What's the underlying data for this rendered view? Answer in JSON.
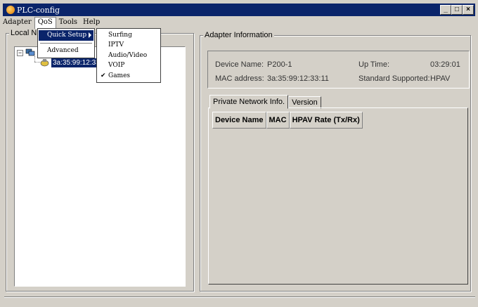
{
  "window": {
    "title": "PLC-config"
  },
  "menubar": {
    "items": [
      "Adapter",
      "QoS",
      "Tools",
      "Help"
    ]
  },
  "qos_menu": {
    "items": [
      "Quick Setup",
      "Advanced"
    ]
  },
  "quick_setup_menu": {
    "items": [
      "Surfing",
      "IPTV",
      "Audio/Video",
      "VOIP",
      "Games"
    ],
    "checked": "Games"
  },
  "local_network": {
    "title": "Local N",
    "selected_node": "3a:35:99:12:33:1"
  },
  "adapter_info": {
    "title": "Adapter Information",
    "device_name_label": "Device Name:",
    "device_name": "P200-1",
    "mac_label": "MAC address:",
    "mac": "3a:35:99:12:33:11",
    "uptime_label": "Up Time:",
    "uptime": "03:29:01",
    "standard_label": "Standard Supported:",
    "standard": "HPAV"
  },
  "tabs": [
    "Private Network Info.",
    "Version"
  ],
  "table": {
    "columns": [
      "Device Name",
      "MAC",
      "HPAV Rate (Tx/Rx)"
    ]
  }
}
